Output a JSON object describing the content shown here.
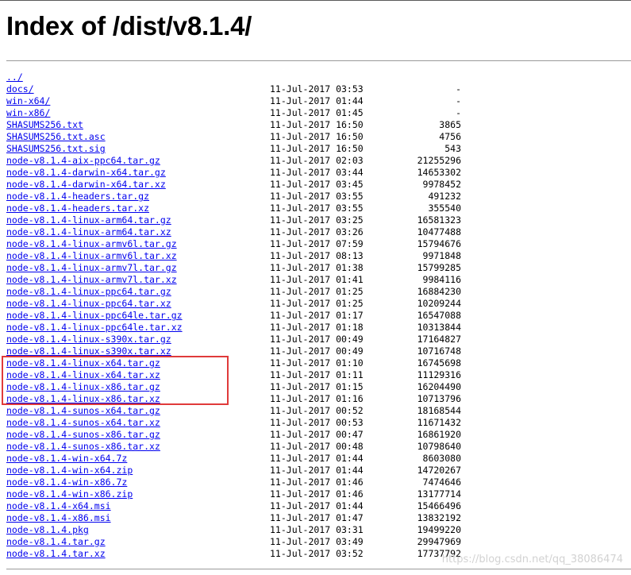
{
  "page": {
    "title": "Index of /dist/v8.1.4/"
  },
  "rows": [
    {
      "name": "../",
      "date": "",
      "size": ""
    },
    {
      "name": "docs/",
      "date": "11-Jul-2017 03:53",
      "size": "-"
    },
    {
      "name": "win-x64/",
      "date": "11-Jul-2017 01:44",
      "size": "-"
    },
    {
      "name": "win-x86/",
      "date": "11-Jul-2017 01:45",
      "size": "-"
    },
    {
      "name": "SHASUMS256.txt",
      "date": "11-Jul-2017 16:50",
      "size": "3865"
    },
    {
      "name": "SHASUMS256.txt.asc",
      "date": "11-Jul-2017 16:50",
      "size": "4756"
    },
    {
      "name": "SHASUMS256.txt.sig",
      "date": "11-Jul-2017 16:50",
      "size": "543"
    },
    {
      "name": "node-v8.1.4-aix-ppc64.tar.gz",
      "date": "11-Jul-2017 02:03",
      "size": "21255296"
    },
    {
      "name": "node-v8.1.4-darwin-x64.tar.gz",
      "date": "11-Jul-2017 03:44",
      "size": "14653302"
    },
    {
      "name": "node-v8.1.4-darwin-x64.tar.xz",
      "date": "11-Jul-2017 03:45",
      "size": "9978452"
    },
    {
      "name": "node-v8.1.4-headers.tar.gz",
      "date": "11-Jul-2017 03:55",
      "size": "491232"
    },
    {
      "name": "node-v8.1.4-headers.tar.xz",
      "date": "11-Jul-2017 03:55",
      "size": "355540"
    },
    {
      "name": "node-v8.1.4-linux-arm64.tar.gz",
      "date": "11-Jul-2017 03:25",
      "size": "16581323"
    },
    {
      "name": "node-v8.1.4-linux-arm64.tar.xz",
      "date": "11-Jul-2017 03:26",
      "size": "10477488"
    },
    {
      "name": "node-v8.1.4-linux-armv6l.tar.gz",
      "date": "11-Jul-2017 07:59",
      "size": "15794676"
    },
    {
      "name": "node-v8.1.4-linux-armv6l.tar.xz",
      "date": "11-Jul-2017 08:13",
      "size": "9971848"
    },
    {
      "name": "node-v8.1.4-linux-armv7l.tar.gz",
      "date": "11-Jul-2017 01:38",
      "size": "15799285"
    },
    {
      "name": "node-v8.1.4-linux-armv7l.tar.xz",
      "date": "11-Jul-2017 01:41",
      "size": "9984116"
    },
    {
      "name": "node-v8.1.4-linux-ppc64.tar.gz",
      "date": "11-Jul-2017 01:25",
      "size": "16884230"
    },
    {
      "name": "node-v8.1.4-linux-ppc64.tar.xz",
      "date": "11-Jul-2017 01:25",
      "size": "10209244"
    },
    {
      "name": "node-v8.1.4-linux-ppc64le.tar.gz",
      "date": "11-Jul-2017 01:17",
      "size": "16547088"
    },
    {
      "name": "node-v8.1.4-linux-ppc64le.tar.xz",
      "date": "11-Jul-2017 01:18",
      "size": "10313844"
    },
    {
      "name": "node-v8.1.4-linux-s390x.tar.gz",
      "date": "11-Jul-2017 00:49",
      "size": "17164827"
    },
    {
      "name": "node-v8.1.4-linux-s390x.tar.xz",
      "date": "11-Jul-2017 00:49",
      "size": "10716748"
    },
    {
      "name": "node-v8.1.4-linux-x64.tar.gz",
      "date": "11-Jul-2017 01:10",
      "size": "16745698"
    },
    {
      "name": "node-v8.1.4-linux-x64.tar.xz",
      "date": "11-Jul-2017 01:11",
      "size": "11129316"
    },
    {
      "name": "node-v8.1.4-linux-x86.tar.gz",
      "date": "11-Jul-2017 01:15",
      "size": "16204490"
    },
    {
      "name": "node-v8.1.4-linux-x86.tar.xz",
      "date": "11-Jul-2017 01:16",
      "size": "10713796"
    },
    {
      "name": "node-v8.1.4-sunos-x64.tar.gz",
      "date": "11-Jul-2017 00:52",
      "size": "18168544"
    },
    {
      "name": "node-v8.1.4-sunos-x64.tar.xz",
      "date": "11-Jul-2017 00:53",
      "size": "11671432"
    },
    {
      "name": "node-v8.1.4-sunos-x86.tar.gz",
      "date": "11-Jul-2017 00:47",
      "size": "16861920"
    },
    {
      "name": "node-v8.1.4-sunos-x86.tar.xz",
      "date": "11-Jul-2017 00:48",
      "size": "10798640"
    },
    {
      "name": "node-v8.1.4-win-x64.7z",
      "date": "11-Jul-2017 01:44",
      "size": "8603080"
    },
    {
      "name": "node-v8.1.4-win-x64.zip",
      "date": "11-Jul-2017 01:44",
      "size": "14720267"
    },
    {
      "name": "node-v8.1.4-win-x86.7z",
      "date": "11-Jul-2017 01:46",
      "size": "7474646"
    },
    {
      "name": "node-v8.1.4-win-x86.zip",
      "date": "11-Jul-2017 01:46",
      "size": "13177714"
    },
    {
      "name": "node-v8.1.4-x64.msi",
      "date": "11-Jul-2017 01:44",
      "size": "15466496"
    },
    {
      "name": "node-v8.1.4-x86.msi",
      "date": "11-Jul-2017 01:47",
      "size": "13832192"
    },
    {
      "name": "node-v8.1.4.pkg",
      "date": "11-Jul-2017 03:31",
      "size": "19499220"
    },
    {
      "name": "node-v8.1.4.tar.gz",
      "date": "11-Jul-2017 03:49",
      "size": "29947969"
    },
    {
      "name": "node-v8.1.4.tar.xz",
      "date": "11-Jul-2017 03:52",
      "size": "17737792"
    }
  ],
  "watermark": "https://blog.csdn.net/qq_38086474",
  "colors": {
    "link": "#0000ee",
    "highlight": "#e03a3a",
    "rule": "#9a9a9a"
  }
}
